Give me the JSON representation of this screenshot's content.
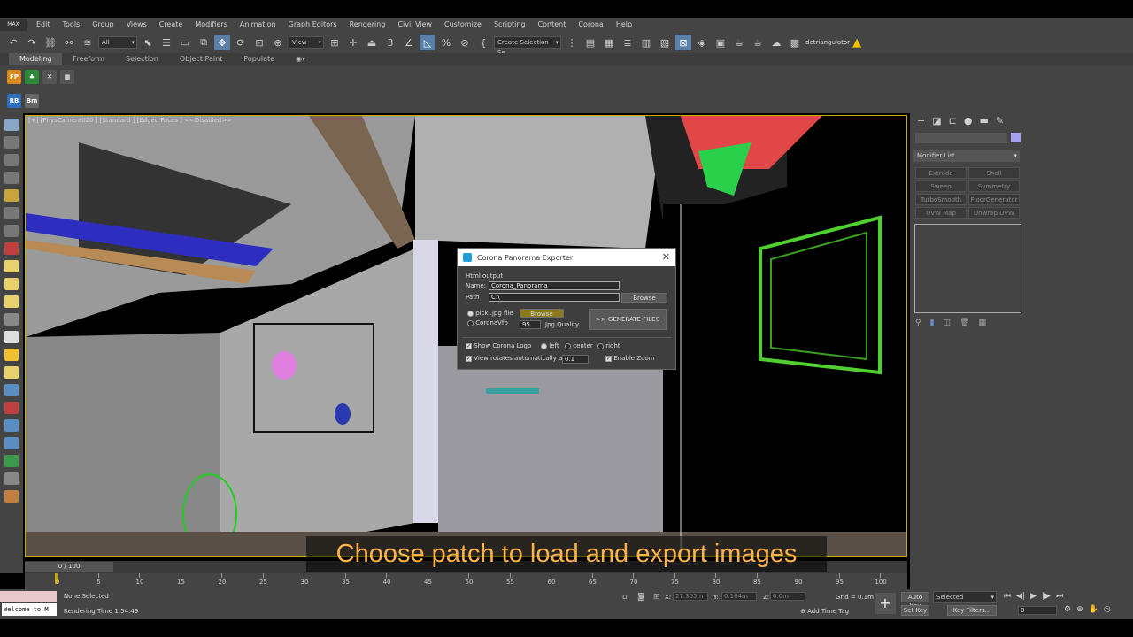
{
  "menu": {
    "logo": "MAX",
    "items": [
      "Edit",
      "Tools",
      "Group",
      "Views",
      "Create",
      "Modifiers",
      "Animation",
      "Graph Editors",
      "Rendering",
      "Civil View",
      "Customize",
      "Scripting",
      "Content",
      "Corona",
      "Help"
    ]
  },
  "toolbar": {
    "filter": "All",
    "refcoord": "View",
    "selection_set": "Create Selection Se",
    "plugin_label": "detriangulator"
  },
  "ribbon": {
    "tabs": [
      "Modeling",
      "Freeform",
      "Selection",
      "Object Paint",
      "Populate"
    ]
  },
  "row3": {
    "rb": "RB",
    "bm": "Bm"
  },
  "viewport": {
    "label": "[+] [PhysCamera020 ] [Standard ] [Edged Faces ] <<Disabled>>"
  },
  "dialog": {
    "title": "Corona Panorama Exporter",
    "section": "Html output",
    "name_label": "Name:",
    "name_value": "Corona_Panorama",
    "path_label": "Path",
    "path_value": "C:\\",
    "browse_label": "Browse",
    "pick_jpg_label": "pick .jpg file",
    "browse2_label": "Browse",
    "coronavfb_label": "CoronaVfb",
    "quality_value": "95",
    "quality_label": "Jpg Quality",
    "generate_label": ">> GENERATE FILES",
    "show_logo_label": "Show Corona Logo",
    "left_label": "left",
    "center_label": "center",
    "right_label": "right",
    "view_rotates_label": "View rotates automatically at",
    "rotate_value": "0.1",
    "enable_zoom_label": "Enable Zoom"
  },
  "cmdpanel": {
    "modifier_list": "Modifier List",
    "buttons": [
      "Extrude",
      "Shell",
      "Sweep",
      "Symmetry",
      "TurboSmooth",
      "FloorGenerator",
      "UVW Map",
      "Unwrap UVW"
    ]
  },
  "timeline": {
    "frame": "0 / 100",
    "ticks": [
      "0",
      "5",
      "10",
      "15",
      "20",
      "25",
      "30",
      "35",
      "40",
      "45",
      "50",
      "55",
      "60",
      "65",
      "70",
      "75",
      "80",
      "85",
      "90",
      "95",
      "100"
    ]
  },
  "status": {
    "script": "Welcome to M",
    "selection": "None Selected",
    "rendering_time": "Rendering Time  1:54:49",
    "x_label": "X:",
    "x_value": "27.305m",
    "y_label": "Y:",
    "y_value": "0.164m",
    "z_label": "Z:",
    "z_value": "0.0m",
    "grid": "Grid = 0.1m",
    "add_time_tag": "Add Time Tag",
    "auto_key": "Auto Key",
    "selected": "Selected",
    "set_key": "Set Key",
    "key_filters": "Key Filters...",
    "frame_field": "0"
  },
  "subtitle": "Choose patch to load and export images"
}
